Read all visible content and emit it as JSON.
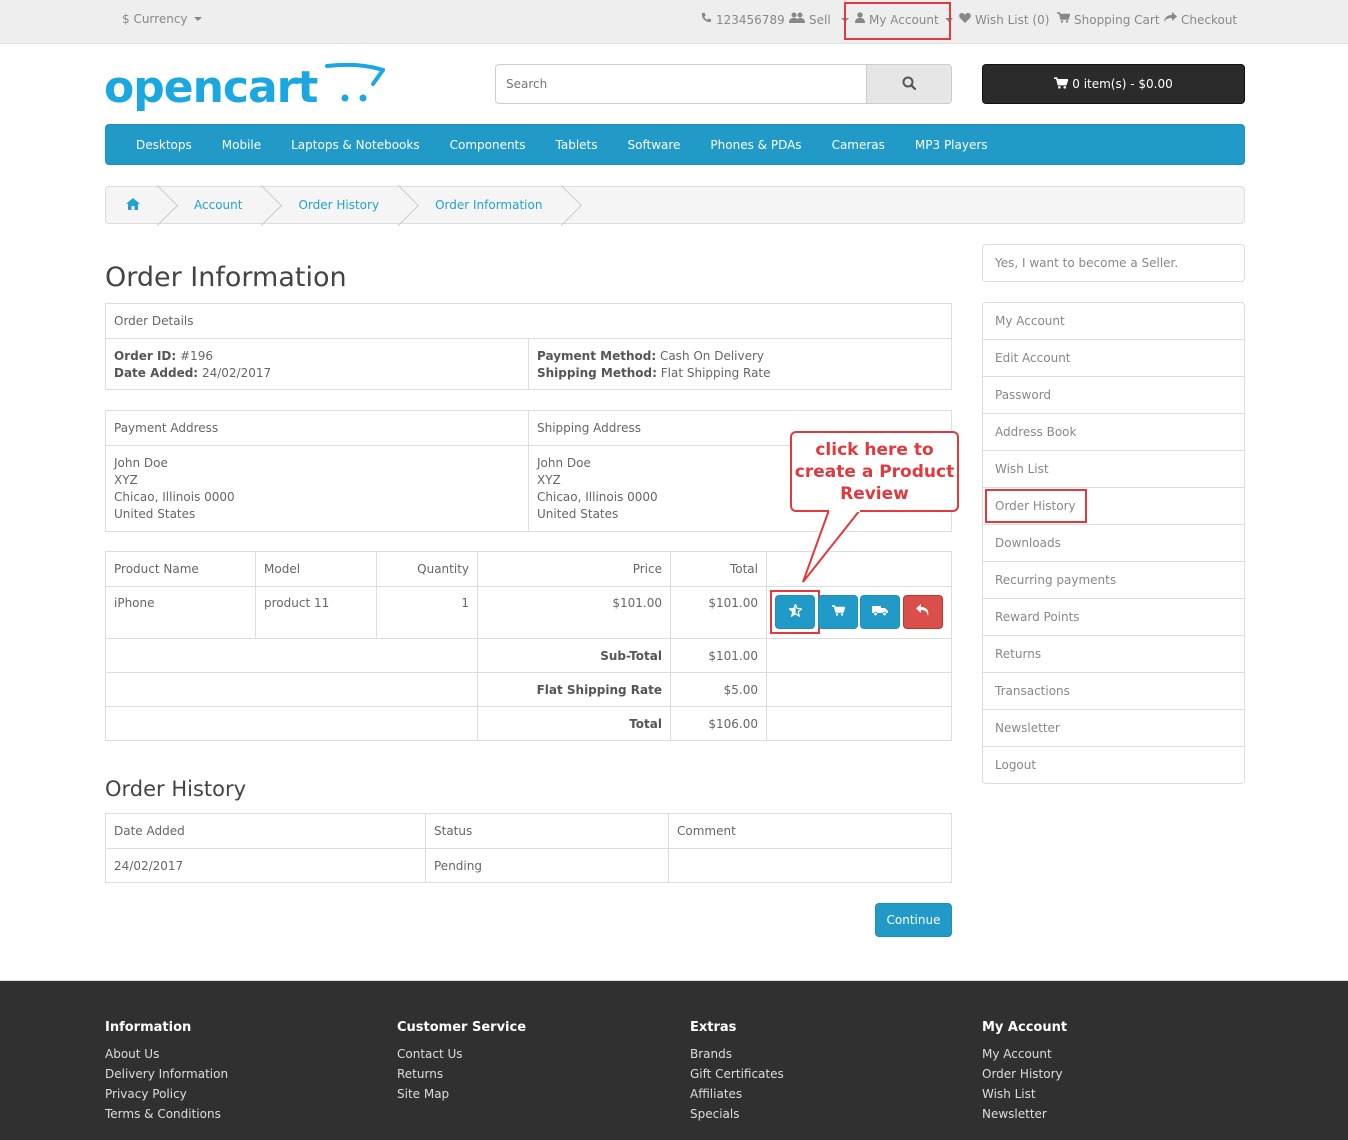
{
  "topbar": {
    "currency": "$ Currency",
    "phone": "123456789",
    "sell": "Sell",
    "my_account": "My Account",
    "wish_list": "Wish List (0)",
    "shopping_cart": "Shopping Cart",
    "checkout": "Checkout"
  },
  "header": {
    "logo_text": "opencart",
    "search_placeholder": "Search",
    "cart_label": "0 item(s) - $0.00"
  },
  "menu": [
    "Desktops",
    "Mobile",
    "Laptops & Notebooks",
    "Components",
    "Tablets",
    "Software",
    "Phones & PDAs",
    "Cameras",
    "MP3 Players"
  ],
  "breadcrumb": [
    "Account",
    "Order History",
    "Order Information"
  ],
  "page_title": "Order Information",
  "order_details": {
    "header": "Order Details",
    "order_id_label": "Order ID:",
    "order_id": "#196",
    "date_added_label": "Date Added:",
    "date_added": "24/02/2017",
    "payment_method_label": "Payment Method:",
    "payment_method": "Cash On Delivery",
    "shipping_method_label": "Shipping Method:",
    "shipping_method": "Flat Shipping Rate"
  },
  "addresses": {
    "payment_header": "Payment Address",
    "shipping_header": "Shipping Address",
    "payment": [
      "John Doe",
      "XYZ",
      "Chicao, Illinois 0000",
      "United States"
    ],
    "shipping": [
      "John Doe",
      "XYZ",
      "Chicao, Illinois 0000",
      "United States"
    ]
  },
  "products": {
    "headers": {
      "name": "Product Name",
      "model": "Model",
      "quantity": "Quantity",
      "price": "Price",
      "total": "Total"
    },
    "row": {
      "name": "iPhone",
      "model": "product 11",
      "quantity": "1",
      "price": "$101.00",
      "total": "$101.00"
    },
    "totals": [
      {
        "label": "Sub-Total",
        "value": "$101.00"
      },
      {
        "label": "Flat Shipping Rate",
        "value": "$5.00"
      },
      {
        "label": "Total",
        "value": "$106.00"
      }
    ]
  },
  "callout": "click here to create a Product Review",
  "history": {
    "title": "Order History",
    "headers": {
      "date": "Date Added",
      "status": "Status",
      "comment": "Comment"
    },
    "row": {
      "date": "24/02/2017",
      "status": "Pending",
      "comment": ""
    }
  },
  "continue_label": "Continue",
  "sidebar": {
    "seller": "Yes, I want to become a Seller.",
    "items": [
      "My Account",
      "Edit Account",
      "Password",
      "Address Book",
      "Wish List",
      "Order History",
      "Downloads",
      "Recurring payments",
      "Reward Points",
      "Returns",
      "Transactions",
      "Newsletter",
      "Logout"
    ]
  },
  "footer": {
    "information": {
      "title": "Information",
      "links": [
        "About Us",
        "Delivery Information",
        "Privacy Policy",
        "Terms & Conditions"
      ]
    },
    "customer_service": {
      "title": "Customer Service",
      "links": [
        "Contact Us",
        "Returns",
        "Site Map"
      ]
    },
    "extras": {
      "title": "Extras",
      "links": [
        "Brands",
        "Gift Certificates",
        "Affiliates",
        "Specials"
      ]
    },
    "my_account": {
      "title": "My Account",
      "links": [
        "My Account",
        "Order History",
        "Wish List",
        "Newsletter"
      ]
    }
  },
  "colors": {
    "primary": "#229ac8",
    "danger": "#da4f49",
    "highlight": "#e03a3e",
    "footer": "#303030"
  }
}
